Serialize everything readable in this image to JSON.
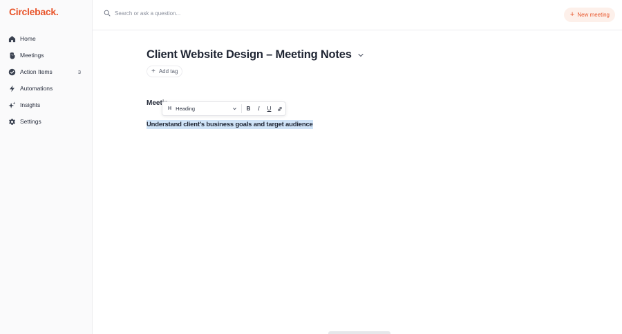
{
  "app": {
    "logo": "Circleback",
    "logo_dot": "."
  },
  "colors": {
    "accent": "#e8552b",
    "accent_bg": "#fdf0ea",
    "selection": "#cfe3f7"
  },
  "sidebar": {
    "items": [
      {
        "label": "Home",
        "icon": "home-icon"
      },
      {
        "label": "Meetings",
        "icon": "meetings-icon"
      },
      {
        "label": "Action Items",
        "icon": "check-circle-icon",
        "count": "3"
      },
      {
        "label": "Automations",
        "icon": "lightning-icon"
      },
      {
        "label": "Insights",
        "icon": "sparkles-icon"
      },
      {
        "label": "Settings",
        "icon": "gear-icon"
      }
    ]
  },
  "header": {
    "search_placeholder": "Search or ask a question...",
    "new_meeting_label": "New meeting"
  },
  "main": {
    "title": "Client Website Design – Meeting Notes",
    "add_tag_label": "Add tag",
    "doc_heading": "Meeting",
    "selected_text": "Understand client's business goals and target audience"
  },
  "toolbar": {
    "block_type": "Heading",
    "block_icon": "H",
    "bold": "B",
    "italic": "I",
    "underline": "U"
  }
}
